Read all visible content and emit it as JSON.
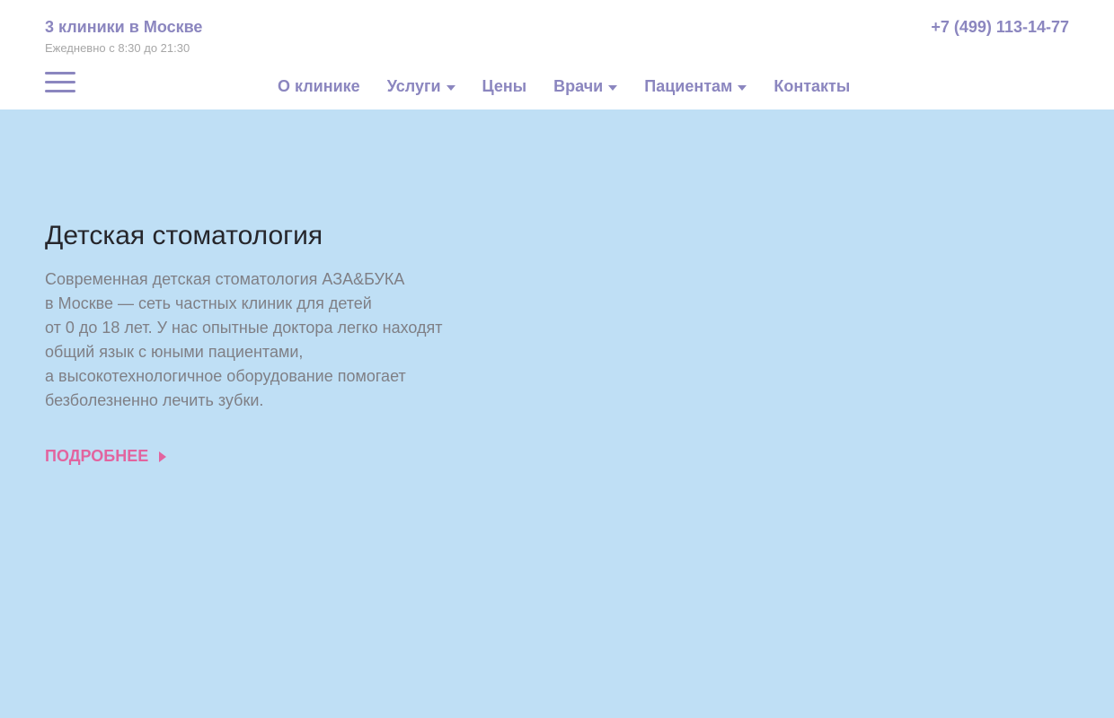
{
  "header": {
    "clinics_title": "3 клиники в Москве",
    "hours": "Ежедневно с 8:30 до 21:30",
    "phone": "+7 (499) 113-14-77"
  },
  "nav": {
    "items": [
      {
        "label": "О клинике",
        "has_dropdown": false
      },
      {
        "label": "Услуги",
        "has_dropdown": true
      },
      {
        "label": "Цены",
        "has_dropdown": false
      },
      {
        "label": "Врачи",
        "has_dropdown": true
      },
      {
        "label": "Пациентам",
        "has_dropdown": true
      },
      {
        "label": "Контакты",
        "has_dropdown": false
      }
    ]
  },
  "hero": {
    "title": "Детская стоматология",
    "description_lines": [
      "Современная детская стоматология АЗА&БУКА",
      "в Москве — сеть частных клиник для детей",
      "от 0 до 18 лет. У нас опытные доктора легко находят",
      "общий язык с юными пациентами,",
      "а высокотехнологичное оборудование помогает",
      "безболезненно лечить зубки."
    ],
    "more_label": "ПОДРОБНЕЕ"
  },
  "colors": {
    "accent": "#8b86bf",
    "link": "#e2649f",
    "hero_bg": "#bfdff5"
  },
  "icons": {
    "menu": "hamburger-menu-icon",
    "dropdown": "caret-down-icon",
    "more": "arrow-right-icon"
  }
}
